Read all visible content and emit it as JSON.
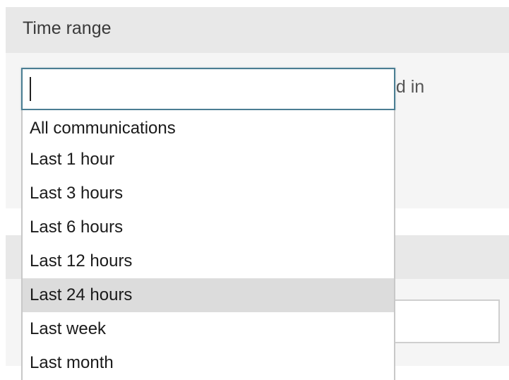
{
  "section": {
    "title": "Time range",
    "hint_fragment": "ed in"
  },
  "select": {
    "value": "",
    "options": [
      {
        "label": "All communications",
        "highlighted": false
      },
      {
        "label": "Last 1 hour",
        "highlighted": false
      },
      {
        "label": "Last 3 hours",
        "highlighted": false
      },
      {
        "label": "Last 6 hours",
        "highlighted": false
      },
      {
        "label": "Last 12 hours",
        "highlighted": false
      },
      {
        "label": "Last 24 hours",
        "highlighted": true
      },
      {
        "label": "Last week",
        "highlighted": false
      },
      {
        "label": "Last month",
        "highlighted": false
      }
    ]
  },
  "colors": {
    "focus_border": "#4b7e93",
    "highlight_bg": "#dcdcdc",
    "header_bg": "#e8e8e8",
    "body_bg": "#f5f5f5"
  }
}
